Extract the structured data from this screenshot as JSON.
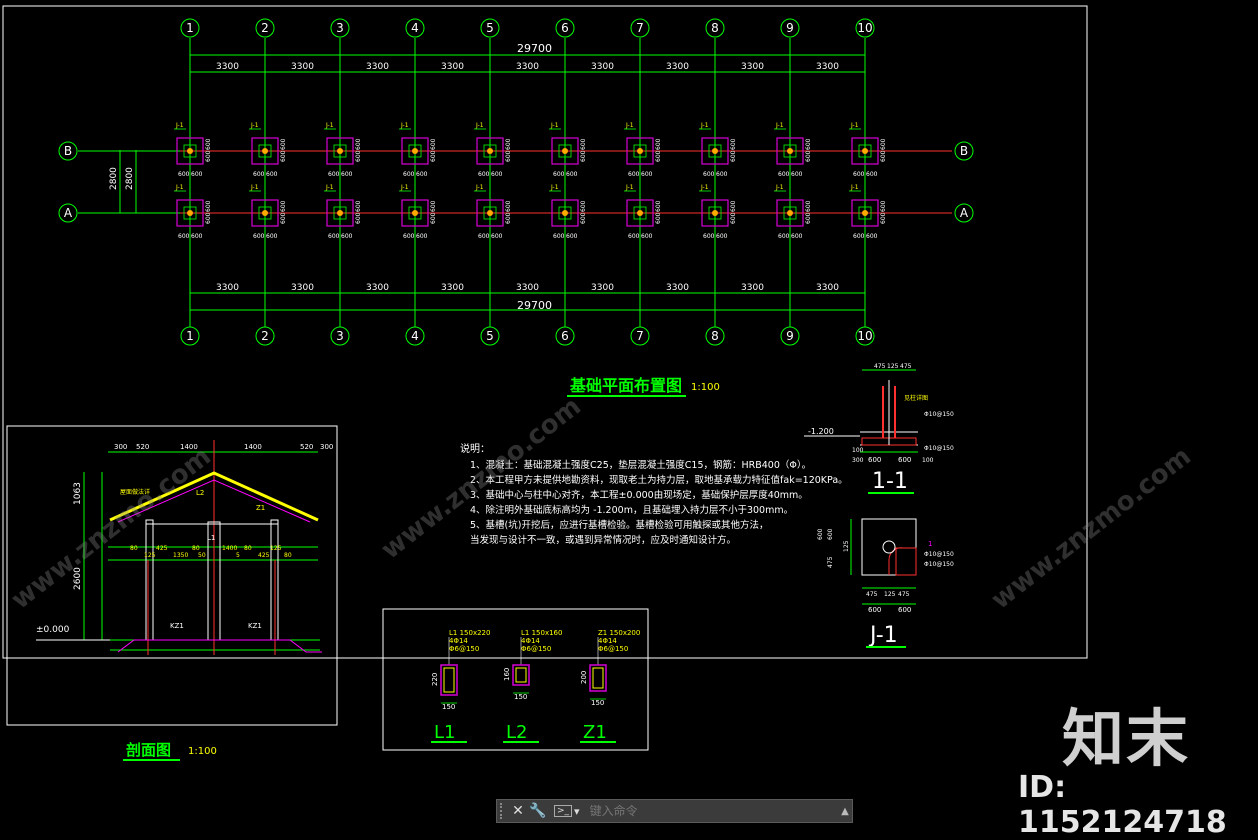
{
  "plan": {
    "grid_numbers": [
      "1",
      "2",
      "3",
      "4",
      "5",
      "6",
      "7",
      "8",
      "9",
      "10"
    ],
    "row_labels": [
      "B",
      "A"
    ],
    "overall_dim": "29700",
    "bay_dim": "3300",
    "row_spacing": "2800",
    "pad_dim": "600",
    "footing_tag": "J-1",
    "title": "基础平面布置图",
    "scale": "1:100"
  },
  "notes": {
    "heading": "说明：",
    "lines": [
      "1、混凝土：基础混凝土强度C25，垫层混凝土强度C15，钢筋：HRB400（Φ）。",
      "2、本工程甲方未提供地勘资料，现取老土为持力层，取地基承载力特征值fak=120KPa。",
      "3、基础中心与柱中心对齐，本工程±0.000由现场定，基础保护层厚度40mm。",
      "4、除注明外基础底标高均为 -1.200m，且基础埋入持力层不小于300mm。",
      "5、基槽(坑)开挖后，应进行基槽检验。基槽检验可用触探或其他方法，",
      "   当发现与设计不一致，或遇到异常情况时，应及时通知设计方。"
    ]
  },
  "section": {
    "title": "剖面图",
    "scale": "1:100",
    "top_dims": [
      "300",
      "520",
      "1400",
      "1400",
      "520",
      "300"
    ],
    "height_total": "2600",
    "height_roof": "1063",
    "level": "±0.000",
    "bottom_dims": [
      "80",
      "125",
      "425",
      "1350",
      "80",
      "50",
      "1400",
      "5",
      "80",
      "425",
      "125",
      "80"
    ],
    "labels": [
      "KZ1",
      "KZ1",
      "L1",
      "L2",
      "Z1"
    ],
    "roof_note": "屋面做法详"
  },
  "detail_1_1": {
    "title": "1-1",
    "top_dims": [
      "475",
      "125",
      "475"
    ],
    "level": "-1.200",
    "bottom_dims": [
      "600",
      "600"
    ],
    "side_dims": [
      "100",
      "300"
    ],
    "rebar1": "Φ10@150",
    "rebar2": "Φ10@150",
    "note": "见柱详图"
  },
  "detail_j1": {
    "title": "J-1",
    "dims_h": [
      "475",
      "125"
    ],
    "dims_v": [
      "600",
      "600",
      "475",
      "125"
    ],
    "bottom_dims": [
      "600",
      "600"
    ],
    "rebar1": "Φ10@150",
    "rebar2": "Φ10@150",
    "marker": "1"
  },
  "beams": [
    {
      "name": "L1",
      "spec": "L1 150x220",
      "bars": "4Φ14",
      "stirrup": "Φ6@150",
      "height": "220",
      "width": "150"
    },
    {
      "name": "L2",
      "spec": "L1 150x160",
      "bars": "4Φ14",
      "stirrup": "Φ6@150",
      "height": "160",
      "width": "150"
    },
    {
      "name": "Z1",
      "spec": "Z1 150x200",
      "bars": "4Φ14",
      "stirrup": "Φ6@150",
      "height": "200",
      "width": "150"
    }
  ],
  "watermark": {
    "logo": "知末",
    "id": "ID: 1152124718",
    "text": "www.znzmo.com"
  },
  "command": {
    "placeholder": "键入命令",
    "prompt_icon": "terminal-icon"
  },
  "colors": {
    "background": "#000000",
    "line_green": "#00ff00",
    "axis_red": "#ff3030",
    "pad_magenta": "#d400d4",
    "text_yellow": "#ffff00",
    "text_white": "#ffffff",
    "column_orange": "#ffaa00"
  }
}
